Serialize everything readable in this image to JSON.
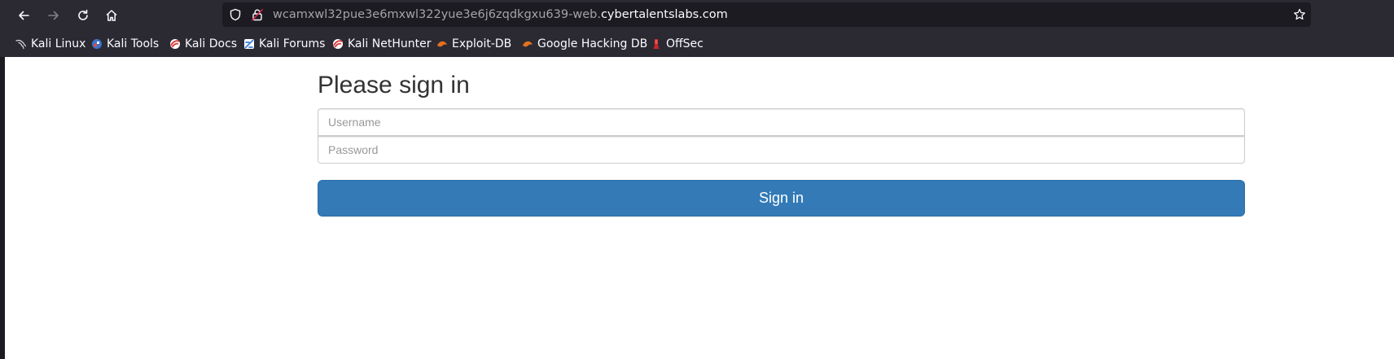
{
  "browser": {
    "url_subdomain": "wcamxwl32pue3e6mxwl322yue3e6j6zqdkgxu639-web.",
    "url_domain": "cybertalentslabs.com",
    "nav_icons": [
      "back-arrow-icon",
      "forward-arrow-icon",
      "reload-icon",
      "home-icon"
    ],
    "url_icons": [
      "shield-icon",
      "insecure-lock-icon",
      "star-icon"
    ]
  },
  "bookmarks": [
    {
      "label": "Kali Linux",
      "icon": "kali-dragon-icon",
      "color": "#cccccc"
    },
    {
      "label": "Kali Tools",
      "icon": "kali-tools-icon",
      "color": "#3d73c8"
    },
    {
      "label": "Kali Docs",
      "icon": "kali-docs-icon",
      "color": "#d83a3a"
    },
    {
      "label": "Kali Forums",
      "icon": "kali-forums-icon",
      "color": "#3a7bd5"
    },
    {
      "label": "Kali NetHunter",
      "icon": "kali-nethunter-icon",
      "color": "#d83a3a"
    },
    {
      "label": "Exploit-DB",
      "icon": "exploit-db-icon",
      "color": "#e4701e"
    },
    {
      "label": "Google Hacking DB",
      "icon": "ghdb-icon",
      "color": "#e4701e"
    },
    {
      "label": "OffSec",
      "icon": "offsec-icon",
      "color": "#c62828"
    }
  ],
  "login": {
    "heading": "Please sign in",
    "username_placeholder": "Username",
    "password_placeholder": "Password",
    "submit_label": "Sign in",
    "button_color": "#337ab7"
  }
}
